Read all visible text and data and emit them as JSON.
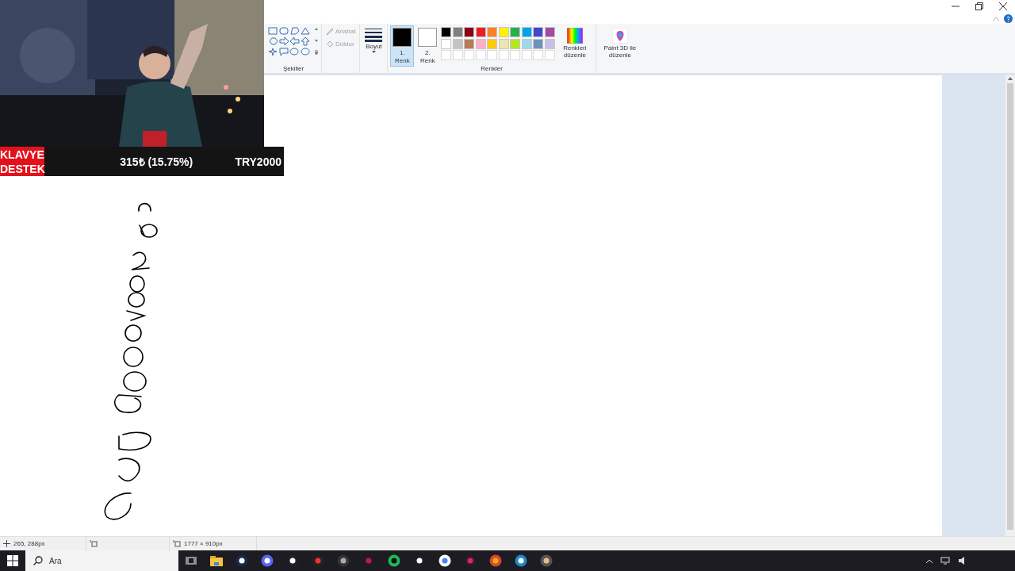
{
  "ribbon": {
    "shapes": {
      "label": "Şekiller"
    },
    "outline": {
      "label": "Anahat",
      "disabled": true
    },
    "fill": {
      "label": "Doldur",
      "disabled": true
    },
    "size": {
      "label": "Boyut"
    },
    "color_slots": [
      {
        "number": "1.",
        "label": "Renk",
        "color": "#000000",
        "selected": true
      },
      {
        "number": "2.",
        "label": "Renk",
        "color": "#ffffff",
        "selected": false
      }
    ],
    "palette": [
      {
        "color": "#000000"
      },
      {
        "color": "#7f7f7f"
      },
      {
        "color": "#880015"
      },
      {
        "color": "#ed1c24"
      },
      {
        "color": "#ff7f27"
      },
      {
        "color": "#fff200"
      },
      {
        "color": "#22b14c"
      },
      {
        "color": "#00a2e8"
      },
      {
        "color": "#3f48cc"
      },
      {
        "color": "#a349a4"
      },
      {
        "color": "#ffffff"
      },
      {
        "color": "#c3c3c3"
      },
      {
        "color": "#b97a57"
      },
      {
        "color": "#ffaec9"
      },
      {
        "color": "#ffc90e"
      },
      {
        "color": "#efe4b0"
      },
      {
        "color": "#b5e61d"
      },
      {
        "color": "#99d9ea"
      },
      {
        "color": "#7092be"
      },
      {
        "color": "#c8bfe7"
      }
    ],
    "edit_colors": {
      "label": "Renkleri düzenle"
    },
    "colors_group": {
      "label": "Renkler"
    },
    "paint3d": {
      "label": "Paint 3D ile düzenle"
    }
  },
  "stream_overlay": {
    "level": 0.1575,
    "left_lines": [
      "KLAVYE",
      "DESTEK"
    ],
    "center": "315₺ (15.75%)",
    "right": "TRY2000"
  },
  "status_bar": {
    "cursor": "265, 288px",
    "canvas_size": "1777 × 910px"
  },
  "taskbar": {
    "search": {
      "placeholder": "Ara"
    }
  }
}
